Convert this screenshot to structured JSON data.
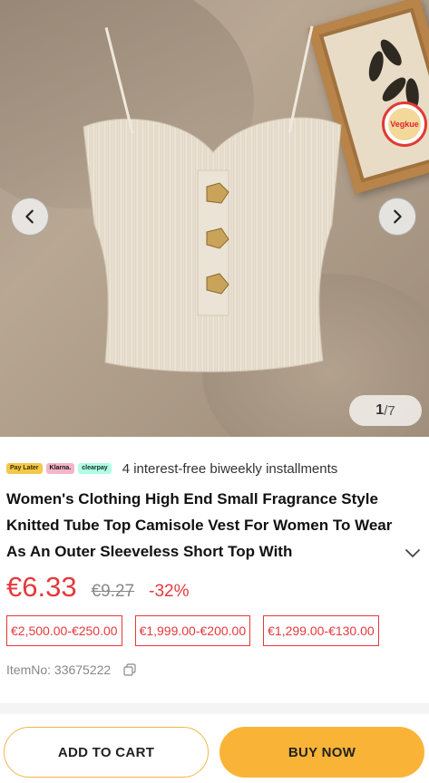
{
  "gallery": {
    "current": "1",
    "total": "/7",
    "badge_text": "Vegkue"
  },
  "payment": {
    "chips": [
      "Pay Later",
      "Klarna.",
      "clearpay"
    ],
    "text": "4 interest-free biweekly installments"
  },
  "product": {
    "title": "Women's Clothing High End Small Fragrance Style Knitted Tube Top Camisole Vest For Women To Wear As An Outer Sleeveless Short Top With",
    "price": "€6.33",
    "original_price": "€9.27",
    "discount": "-32%",
    "coupons": [
      "€2,500.00-€250.00",
      "€1,999.00-€200.00",
      "€1,299.00-€130.00"
    ],
    "item_no": "ItemNo: 33675222"
  },
  "actions": {
    "add_to_cart": "ADD TO CART",
    "buy_now": "BUY NOW"
  },
  "colors": {
    "accent": "#e4393c",
    "buy_button": "#f9b437"
  }
}
